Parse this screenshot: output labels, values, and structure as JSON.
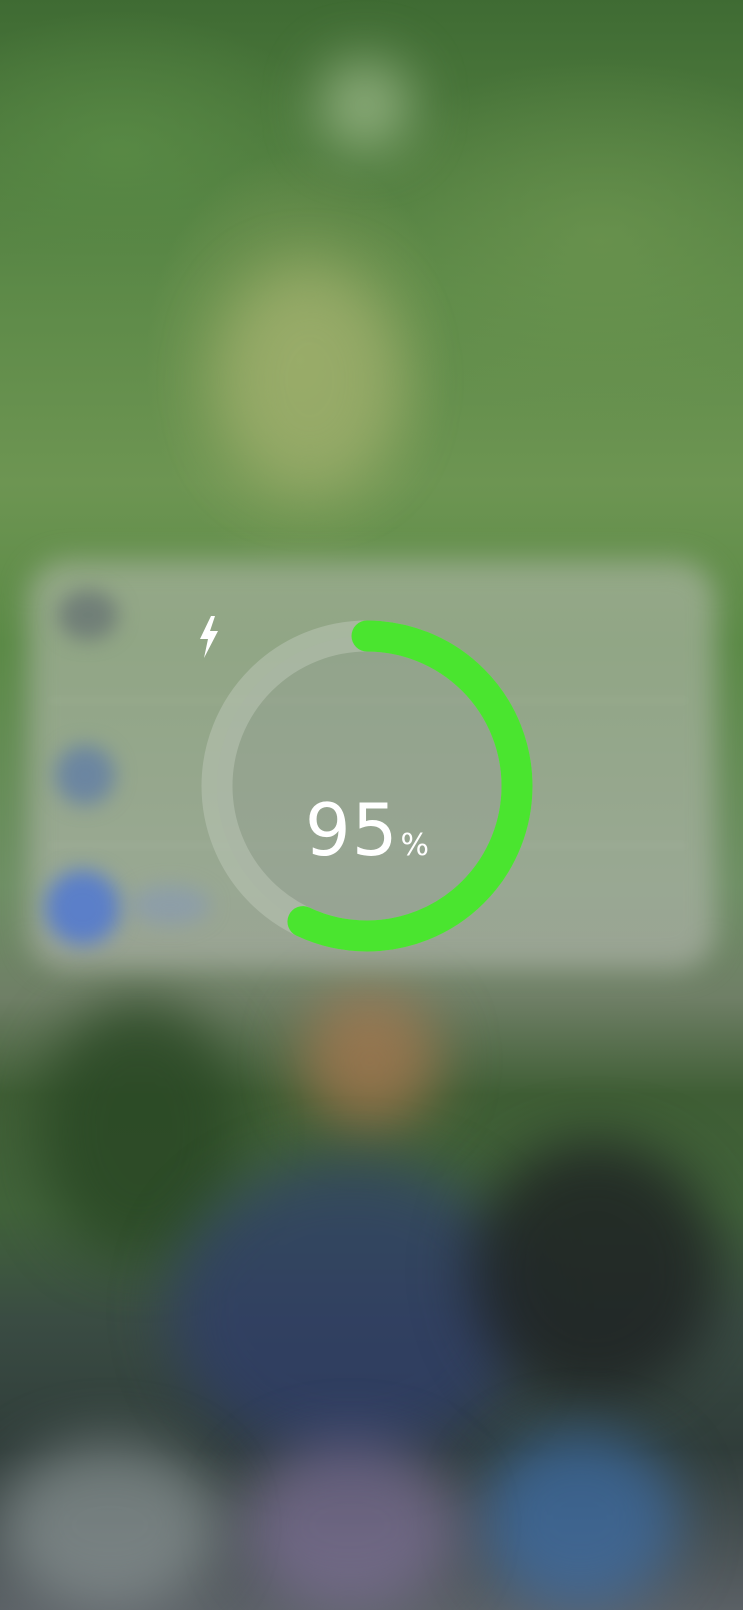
{
  "charging": {
    "level_percent": 95,
    "value_text": "95",
    "unit_text": "%",
    "status_icon": "lightning-bolt-icon",
    "colors": {
      "ring_fill": "#4ae52f",
      "ring_track": "#b9c4b4",
      "text": "#ffffff"
    }
  }
}
